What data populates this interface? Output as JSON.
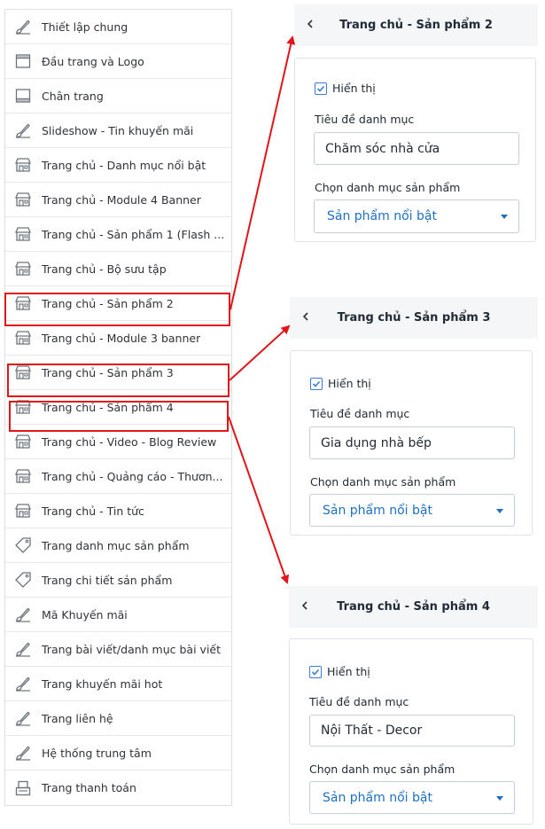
{
  "menu": {
    "items": [
      {
        "label": "Thiết lập chung",
        "icon": "brush-icon"
      },
      {
        "label": "Đầu trang và Logo",
        "icon": "header-layout-icon"
      },
      {
        "label": "Chân trang",
        "icon": "footer-layout-icon"
      },
      {
        "label": "Slideshow - Tin khuyến mãi",
        "icon": "brush-icon"
      },
      {
        "label": "Trang chủ - Danh mục nổi bật",
        "icon": "store-icon"
      },
      {
        "label": "Trang chủ - Module 4 Banner",
        "icon": "store-icon"
      },
      {
        "label": "Trang chủ - Sản phẩm 1 (Flash ...",
        "icon": "store-icon"
      },
      {
        "label": "Trang chủ - Bộ sưu tập",
        "icon": "store-icon"
      },
      {
        "label": "Trang chủ - Sản phẩm 2",
        "icon": "store-icon"
      },
      {
        "label": "Trang chủ - Module 3 banner",
        "icon": "store-icon"
      },
      {
        "label": "Trang chủ - Sản phẩm 3",
        "icon": "store-icon"
      },
      {
        "label": "Trang chủ - Sản phẩm 4",
        "icon": "store-icon"
      },
      {
        "label": "Trang chủ - Video - Blog Review",
        "icon": "store-icon"
      },
      {
        "label": "Trang chủ - Quảng cáo - Thươn...",
        "icon": "store-icon"
      },
      {
        "label": "Trang chủ - Tin tức",
        "icon": "store-icon"
      },
      {
        "label": "Trang danh mục sản phẩm",
        "icon": "tag-icon"
      },
      {
        "label": "Trang chi tiết sản phẩm",
        "icon": "tag-icon"
      },
      {
        "label": "Mã Khuyến mãi",
        "icon": "brush-icon"
      },
      {
        "label": "Trang bài viết/danh mục bài viết",
        "icon": "brush-icon"
      },
      {
        "label": "Trang khuyến mãi hot",
        "icon": "brush-icon"
      },
      {
        "label": "Trang liên hệ",
        "icon": "brush-icon"
      },
      {
        "label": "Hệ thống trung tâm",
        "icon": "brush-icon"
      },
      {
        "label": "Trang thanh toán",
        "icon": "checkout-icon"
      }
    ]
  },
  "panels": [
    {
      "title": "Trang chủ - Sản phẩm 2",
      "show_label": "Hiển thị",
      "show_checked": true,
      "category_title_label": "Tiêu đề danh mục",
      "category_title_value": "Chăm sóc nhà cửa",
      "product_category_label": "Chọn danh mục sản phẩm",
      "product_category_value": "Sản phẩm nổi bật"
    },
    {
      "title": "Trang chủ - Sản phẩm 3",
      "show_label": "Hiển thị",
      "show_checked": true,
      "category_title_label": "Tiêu đề danh mục",
      "category_title_value": "Gia dụng nhà bếp",
      "product_category_label": "Chọn danh mục sản phẩm",
      "product_category_value": "Sản phẩm nổi bật"
    },
    {
      "title": "Trang chủ - Sản phẩm 4",
      "show_label": "Hiển thị",
      "show_checked": true,
      "category_title_label": "Tiêu đề danh mục",
      "category_title_value": "Nội Thất - Decor",
      "product_category_label": "Chọn danh mục sản phẩm",
      "product_category_value": "Sản phẩm nổi bật"
    }
  ],
  "colors": {
    "highlight": "#e0161a",
    "link_blue": "#1d6fc1",
    "checkbox_blue": "#3c7bd6",
    "panel_header_bg": "#f4f6f8"
  }
}
